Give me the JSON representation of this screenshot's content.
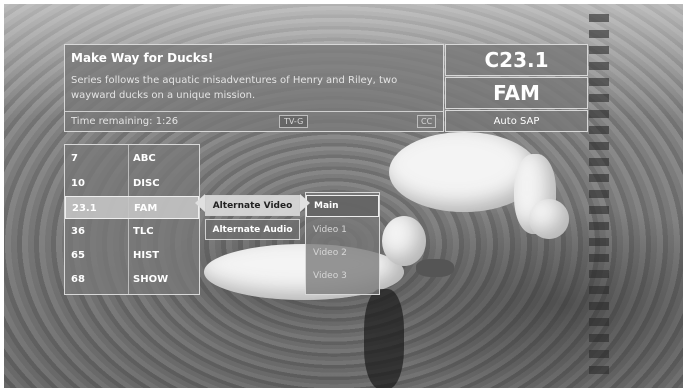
{
  "program": {
    "title": "Make Way for Ducks!",
    "description": "Series follows the aquatic misadventures of Henry and Riley, two wayward ducks on a unique mission.",
    "time_remaining": "Time remaining: 1:26",
    "rating": "TV-G",
    "cc": "CC"
  },
  "channel": {
    "number": "C23.1",
    "network": "FAM",
    "audio": "Auto SAP"
  },
  "channel_list": [
    {
      "number": "7",
      "name": "ABC",
      "selected": false
    },
    {
      "number": "10",
      "name": "DISC",
      "selected": false
    },
    {
      "number": "23.1",
      "name": "FAM",
      "selected": true
    },
    {
      "number": "36",
      "name": "TLC",
      "selected": false
    },
    {
      "number": "65",
      "name": "HIST",
      "selected": false
    },
    {
      "number": "68",
      "name": "SHOW",
      "selected": false
    }
  ],
  "options_menu": [
    {
      "label": "Alternate Video",
      "selected": true
    },
    {
      "label": "Alternate Audio",
      "selected": false
    }
  ],
  "video_options": [
    {
      "label": "Main",
      "selected": true
    },
    {
      "label": "Video 1",
      "selected": false
    },
    {
      "label": "Video 2",
      "selected": false
    },
    {
      "label": "Video 3",
      "selected": false
    }
  ]
}
